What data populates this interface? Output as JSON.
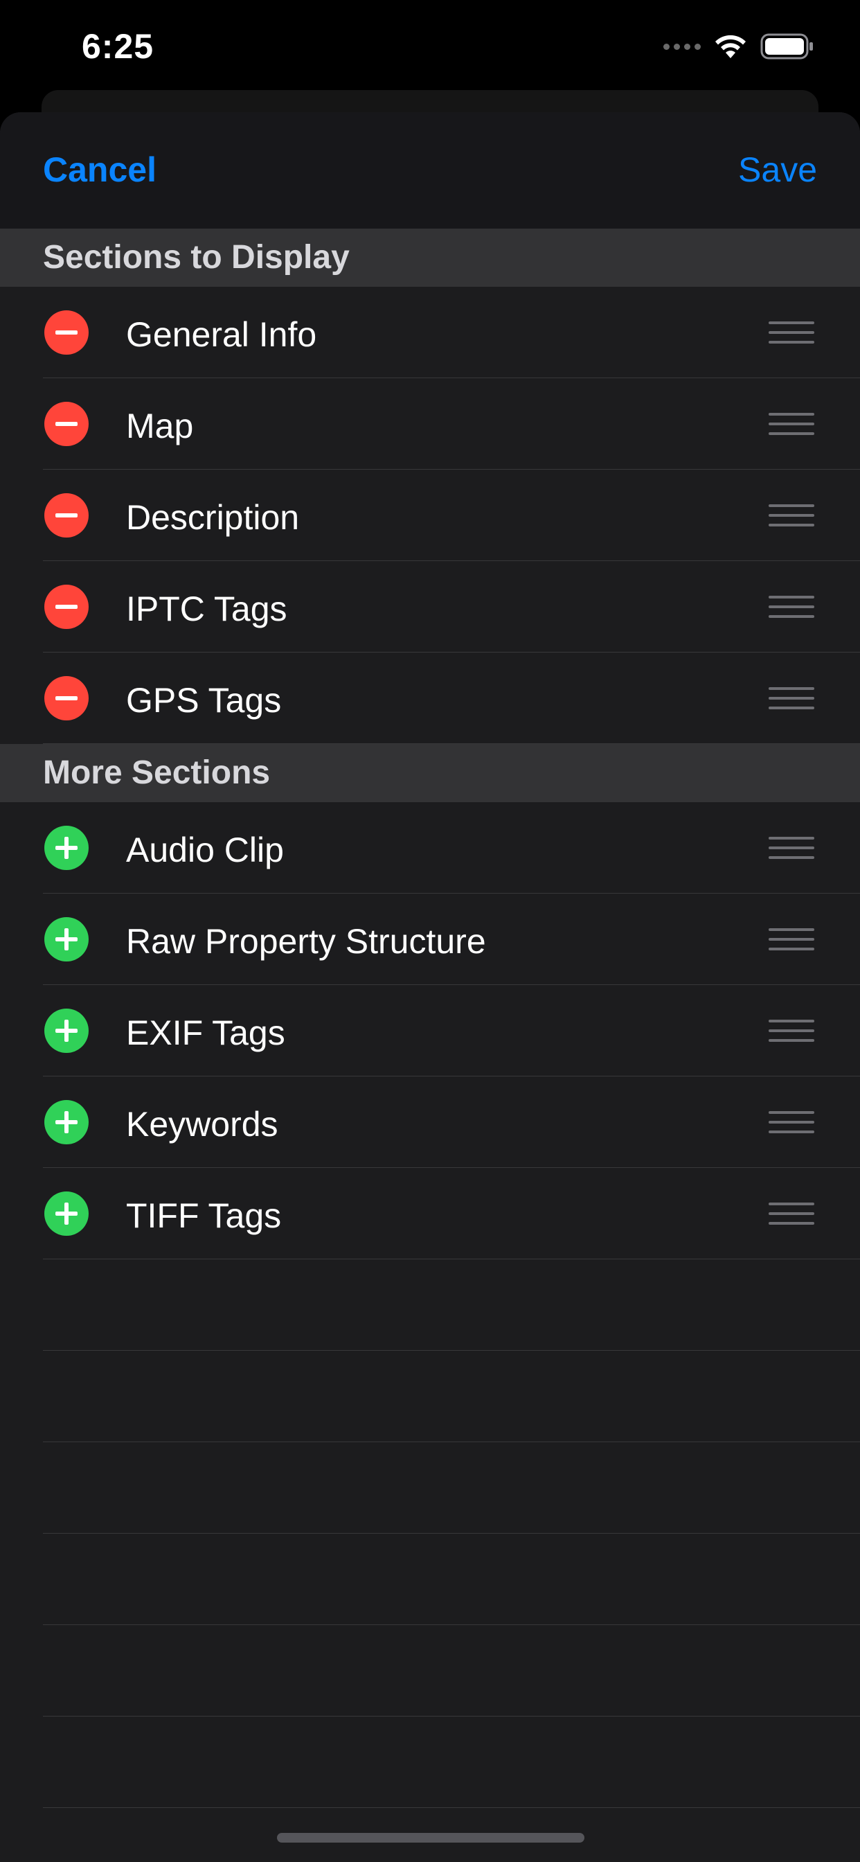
{
  "status_bar": {
    "time": "6:25",
    "icons": [
      "cellular-signal-icon",
      "wifi-icon",
      "battery-icon"
    ]
  },
  "nav": {
    "cancel_label": "Cancel",
    "save_label": "Save"
  },
  "sections": {
    "display": {
      "title": "Sections to Display",
      "items": [
        {
          "label": "General Info"
        },
        {
          "label": "Map"
        },
        {
          "label": "Description"
        },
        {
          "label": "IPTC Tags"
        },
        {
          "label": "GPS Tags"
        }
      ]
    },
    "more": {
      "title": "More Sections",
      "items": [
        {
          "label": "Audio Clip"
        },
        {
          "label": "Raw Property Structure"
        },
        {
          "label": "EXIF Tags"
        },
        {
          "label": "Keywords"
        },
        {
          "label": "TIFF Tags"
        }
      ]
    }
  },
  "colors": {
    "accent": "#0a84ff",
    "remove": "#ff453a",
    "add": "#30d158",
    "background": "#1c1c1e",
    "section_header": "#333335"
  }
}
